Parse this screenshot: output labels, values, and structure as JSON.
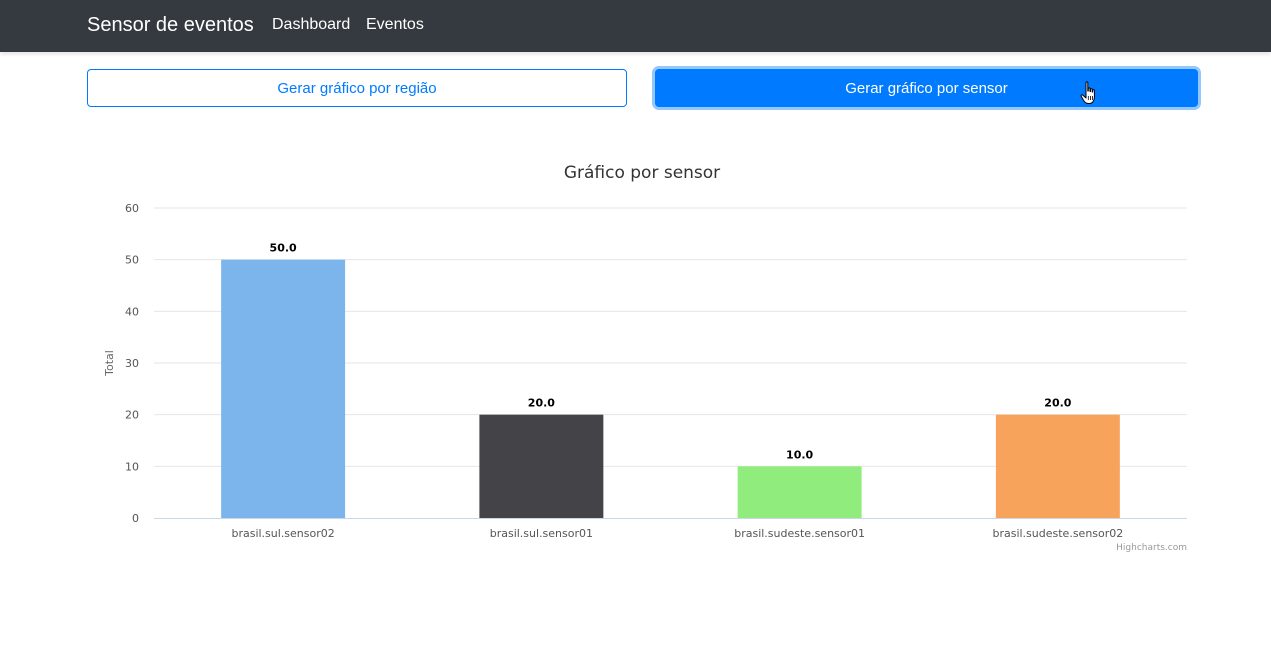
{
  "navbar": {
    "brand": "Sensor de eventos",
    "links": [
      "Dashboard",
      "Eventos"
    ]
  },
  "buttons": {
    "by_region": "Gerar gráfico por região",
    "by_sensor": "Gerar gráfico por sensor"
  },
  "colors": {
    "navbar_bg": "#343a40",
    "primary": "#007bff"
  },
  "chart_data": {
    "type": "bar",
    "title": "Gráfico por sensor",
    "xlabel": "",
    "ylabel": "Total",
    "categories": [
      "brasil.sul.sensor02",
      "brasil.sul.sensor01",
      "brasil.sudeste.sensor01",
      "brasil.sudeste.sensor02"
    ],
    "values": [
      50.0,
      20.0,
      10.0,
      20.0
    ],
    "data_labels": [
      "50.0",
      "20.0",
      "10.0",
      "20.0"
    ],
    "colors": [
      "#7cb5ec",
      "#434348",
      "#90ed7d",
      "#f7a35c"
    ],
    "ylim": [
      0,
      60
    ],
    "yticks": [
      0,
      10,
      20,
      30,
      40,
      50,
      60
    ],
    "grid": true,
    "credits": "Highcharts.com"
  }
}
